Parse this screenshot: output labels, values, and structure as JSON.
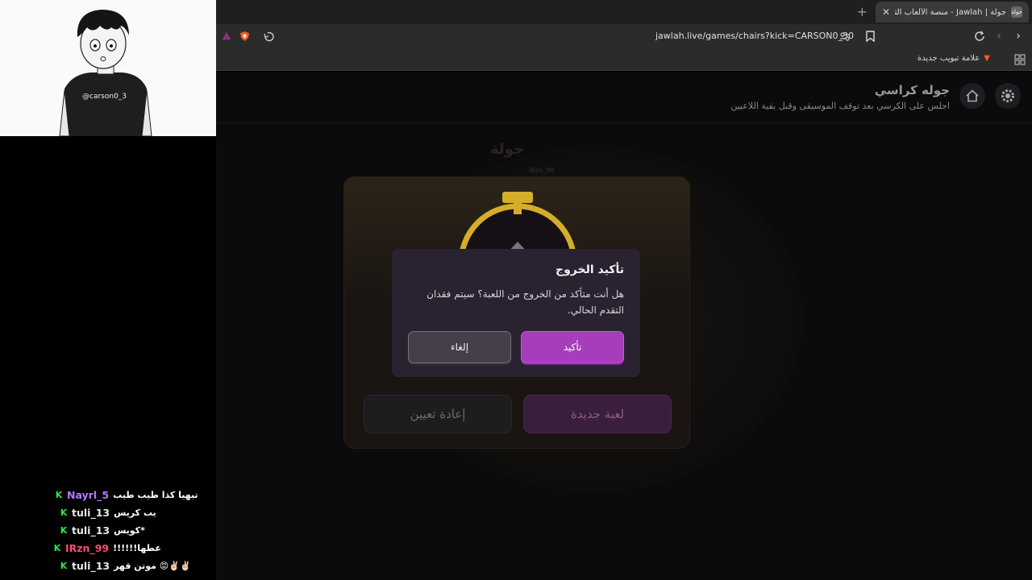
{
  "browser": {
    "tab_title": "جولة | Jawlah - منصة الألعاب التفا",
    "tab_favicon_text": "جولة",
    "url": "jawlah.live/games/chairs?kick=CARSON0_30",
    "bookmark_label": "علامة تبويب جديدة"
  },
  "webcam": {
    "caption": "@carson0_3"
  },
  "game": {
    "title": "جوله كراسي",
    "subtitle": "اجلس على الكرسي بعد توقف الموسيقى وقبل بقية اللاعبين",
    "bg_logo": "جولة",
    "bg_player": "IRzn_99",
    "new_game_label": "لعبة جديدة",
    "reset_label": "إعادة تعيين",
    "colors": {
      "accent": "#a63dba",
      "gold": "#d6ad2a"
    }
  },
  "dialog": {
    "title": "تأكيد الخروج",
    "message": "هل أنت متأكد من الخروج من اللعبة؟ سيتم فقدان التقدم الحالي.",
    "confirm_label": "تأكيد",
    "cancel_label": "إلغاء"
  },
  "chat": [
    {
      "user": "Nayrl_5",
      "user_color": "#b57bff",
      "message": "تبهيا كذا طيب طيب"
    },
    {
      "user": "tuli_13",
      "user_color": "#e8e8e8",
      "message": "يب كريس"
    },
    {
      "user": "tuli_13",
      "user_color": "#e8e8e8",
      "message": "*كويس"
    },
    {
      "user": "IRzn_99",
      "user_color": "#ff4d6d",
      "message": "عطها!!!!!!"
    },
    {
      "user": "tuli_13",
      "user_color": "#e8e8e8",
      "message": "✌🏻✌🏻😡 موتن قهر"
    }
  ]
}
